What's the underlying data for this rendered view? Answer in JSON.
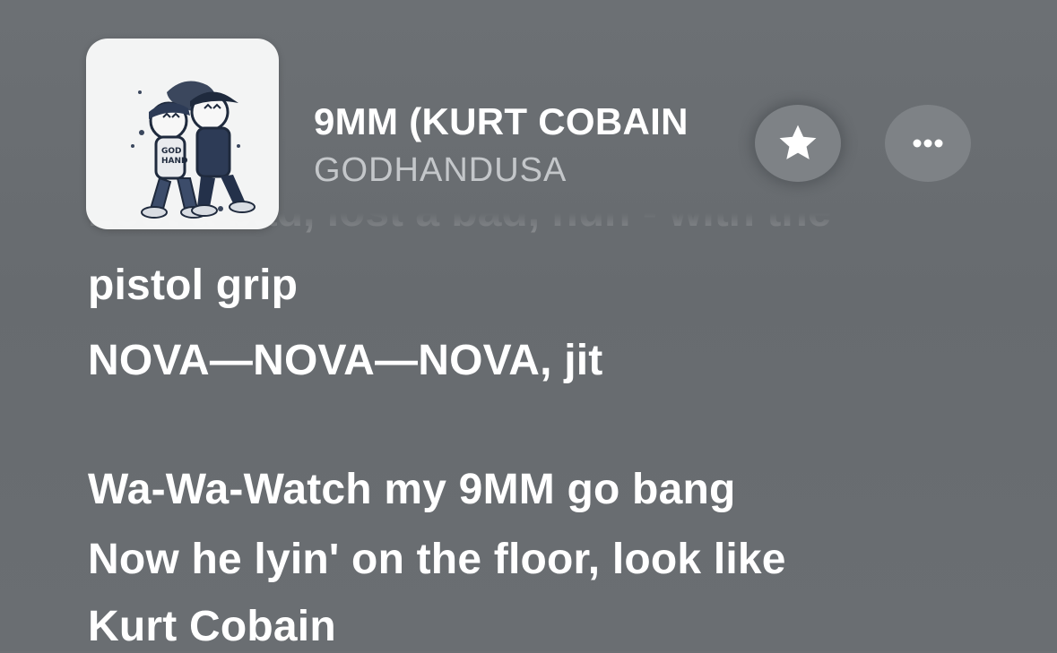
{
  "now_playing": {
    "title": "9MM (KURT COBAIN",
    "artist": "GODHANDUSA",
    "artwork_icon": "album-artwork",
    "artwork_text": "GOD HAND"
  },
  "controls": {
    "favorite_icon": "star-icon",
    "more_icon": "ellipsis-icon"
  },
  "lyrics": {
    "faded_line": "Lost a bad, lost a bad, hun - with the",
    "lines": [
      "pistol grip",
      "NOVA—NOVA—NOVA, jit",
      "",
      "Wa-Wa-Watch my 9MM go bang",
      "Now he lyin' on the floor, look like",
      "Kurt Cobain"
    ]
  },
  "colors": {
    "background": "#6a6e72",
    "button_fill": "#7e8286",
    "artist_text": "#c4c7ca",
    "lyric_text": "#ffffff"
  }
}
